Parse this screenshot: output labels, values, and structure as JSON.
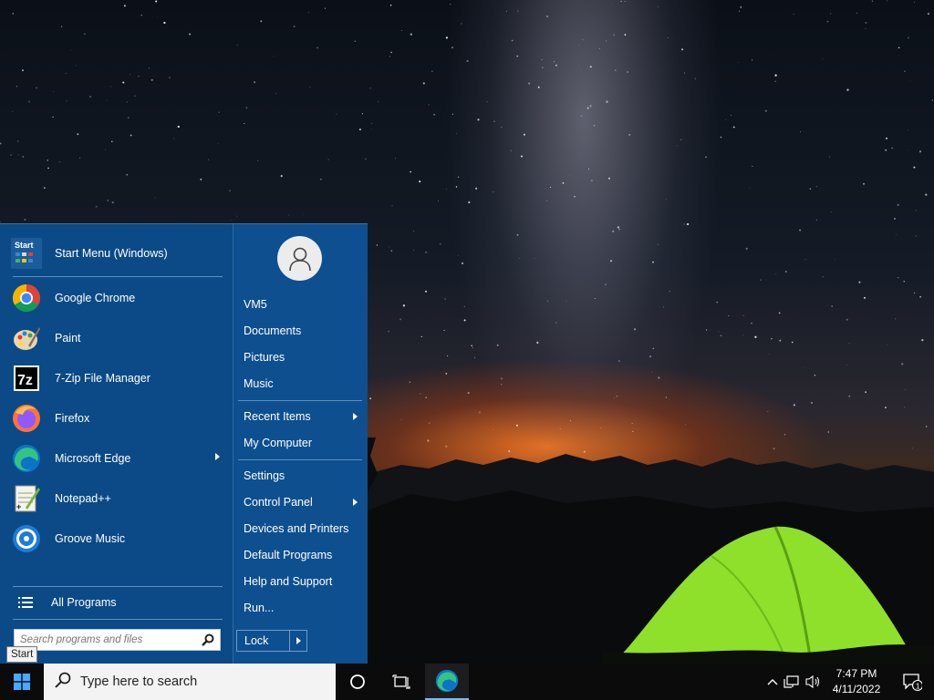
{
  "start_menu": {
    "programs": [
      {
        "label": "Start Menu (Windows)",
        "icon": "start-menu-app-icon",
        "has_submenu": false
      },
      {
        "label": "Google Chrome",
        "icon": "chrome-icon",
        "has_submenu": false
      },
      {
        "label": "Paint",
        "icon": "paint-icon",
        "has_submenu": false
      },
      {
        "label": "7-Zip File Manager",
        "icon": "7zip-icon",
        "has_submenu": false
      },
      {
        "label": "Firefox",
        "icon": "firefox-icon",
        "has_submenu": false
      },
      {
        "label": "Microsoft Edge",
        "icon": "edge-icon",
        "has_submenu": true
      },
      {
        "label": "Notepad++",
        "icon": "notepadpp-icon",
        "has_submenu": false
      },
      {
        "label": "Groove Music",
        "icon": "groove-music-icon",
        "has_submenu": false
      }
    ],
    "start_icon_text": "Start",
    "seven_zip_icon_text": "7z",
    "notepad_icon_text": "+",
    "all_programs_label": "All Programs",
    "search_placeholder": "Search programs and files",
    "right_items": [
      {
        "label": "VM5",
        "has_submenu": false
      },
      {
        "label": "Documents",
        "has_submenu": false
      },
      {
        "label": "Pictures",
        "has_submenu": false
      },
      {
        "label": "Music",
        "has_submenu": false
      },
      {
        "label": "Recent Items",
        "has_submenu": true
      },
      {
        "label": "My Computer",
        "has_submenu": false
      },
      {
        "label": "Settings",
        "has_submenu": false
      },
      {
        "label": "Control Panel",
        "has_submenu": true
      },
      {
        "label": "Devices and Printers",
        "has_submenu": false
      },
      {
        "label": "Default Programs",
        "has_submenu": false
      },
      {
        "label": "Help and Support",
        "has_submenu": false
      },
      {
        "label": "Run...",
        "has_submenu": false
      }
    ],
    "lock_label": "Lock",
    "menu_color": "#0b4a86"
  },
  "tooltip": "Start",
  "taskbar": {
    "search_text": "Type here to search",
    "time": "7:47 PM",
    "date": "4/11/2022",
    "notification_count": "1"
  }
}
